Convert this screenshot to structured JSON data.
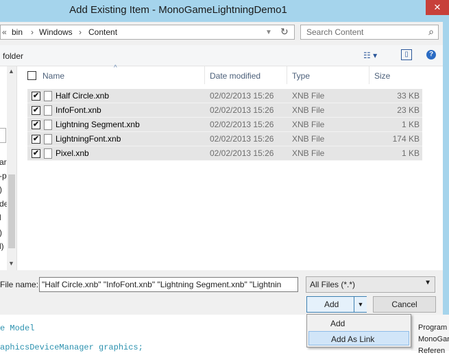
{
  "window": {
    "title": "Add Existing Item - MonoGameLightningDemo1",
    "close_glyph": "✕"
  },
  "address": {
    "crumbs": [
      "«",
      "bin",
      "Windows",
      "Content"
    ],
    "separators": [
      "›",
      "›"
    ],
    "refresh_glyph": "↻"
  },
  "search": {
    "placeholder": "Search Content",
    "icon_glyph": "⌕"
  },
  "toolbar": {
    "new_folder_label": "folder",
    "view_glyph": "☷ ▾",
    "pane_glyph": "▯",
    "help_glyph": "?"
  },
  "nav_pane": {
    "fragments": [
      "ar",
      "-p",
      ")",
      "de",
      "l",
      ")",
      "l)",
      "p"
    ],
    "scroll_up": "▲",
    "scroll_down": "▼"
  },
  "columns": [
    "Name",
    "Date modified",
    "Type",
    "Size"
  ],
  "sort_glyph": "^",
  "files": [
    {
      "name": "Half Circle.xnb",
      "date": "02/02/2013 15:26",
      "type": "XNB File",
      "size": "33 KB",
      "checked": true
    },
    {
      "name": "InfoFont.xnb",
      "date": "02/02/2013 15:26",
      "type": "XNB File",
      "size": "23 KB",
      "checked": true
    },
    {
      "name": "Lightning Segment.xnb",
      "date": "02/02/2013 15:26",
      "type": "XNB File",
      "size": "1 KB",
      "checked": true
    },
    {
      "name": "LightningFont.xnb",
      "date": "02/02/2013 15:26",
      "type": "XNB File",
      "size": "174 KB",
      "checked": true
    },
    {
      "name": "Pixel.xnb",
      "date": "02/02/2013 15:26",
      "type": "XNB File",
      "size": "1 KB",
      "checked": true
    }
  ],
  "check_glyph": "✔",
  "bottom": {
    "filename_label": "File name:",
    "filename_value": "\"Half Circle.xnb\" \"InfoFont.xnb\" \"Lightning Segment.xnb\" \"Lightnin",
    "filetype_value": "All Files (*.*)",
    "add_label": "Add",
    "add_drop_glyph": "▼",
    "cancel_label": "Cancel"
  },
  "menu": {
    "items": [
      "Add",
      "Add As Link"
    ]
  },
  "editor": {
    "lines": [
      "e Model",
      "aphicsDeviceManager graphics;"
    ]
  },
  "solution": {
    "items": [
      "Program",
      "MonoGameL",
      "Referen"
    ]
  }
}
